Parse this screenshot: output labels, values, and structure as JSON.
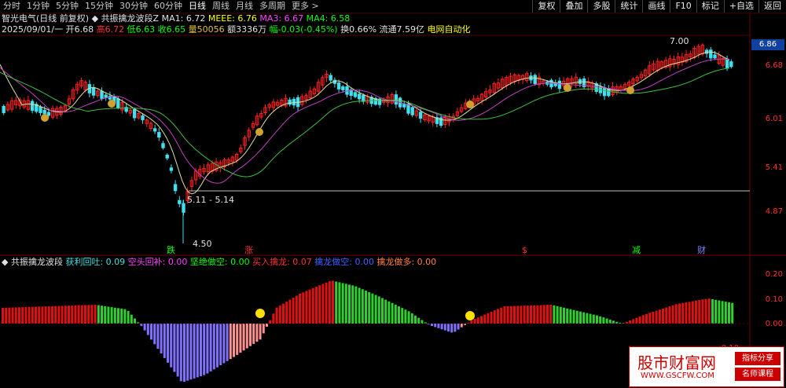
{
  "toolbar": {
    "periods": [
      "分时",
      "1分钟",
      "5分钟",
      "15分钟",
      "30分钟",
      "60分钟",
      "日线",
      "周线",
      "月线",
      "多周期",
      "更多 >"
    ],
    "buttons": [
      "复权",
      "叠加",
      "多股",
      "统计",
      "画线",
      "F10",
      "标记",
      "+自选",
      "返回"
    ]
  },
  "header": {
    "stock": "智光电气(日线 前复权)",
    "indicator": "共振擒龙波段Z",
    "ma1": "MA1: 6.72",
    "meee": "MEEE: 6.76",
    "ma3": "MA3: 6.67",
    "ma4": "MA4: 6.58"
  },
  "quote": {
    "date": "2025/09/01/一",
    "open": "开6.68",
    "high": "高6.72",
    "low": "低6.63",
    "close": "收6.65",
    "volume": "量50056",
    "amount": "额3336万",
    "change": "幅-0.03(-0.45%)",
    "turnover": "换0.66%",
    "float": "流通7.59亿",
    "sector": "电网自动化"
  },
  "price_axis": [
    "6.68",
    "6.01",
    "5.41",
    "4.87"
  ],
  "current_price": "6.86",
  "annotations": {
    "high_label": "7.00",
    "range_label": "5.11 - 5.14",
    "low_label": "4.50",
    "markers": [
      "跌",
      "涨",
      "$",
      "减",
      "财"
    ]
  },
  "sub_indicator": {
    "name": "共振擒龙波段",
    "items": [
      {
        "label": "获利回吐: 0.09",
        "color": "#40e0e0"
      },
      {
        "label": "空头回补: 0.00",
        "color": "#ff40ff"
      },
      {
        "label": "坚绝做空: 0.00",
        "color": "#00ff00"
      },
      {
        "label": "买入擒龙: 0.07",
        "color": "#ff3030"
      },
      {
        "label": "擒龙做空: 0.00",
        "color": "#4060ff"
      },
      {
        "label": "擒龙做多: 0.00",
        "color": "#ff8040"
      }
    ],
    "axis": [
      "0.20",
      "0.10",
      "0.00",
      "-0.10"
    ]
  },
  "watermark": {
    "main": "股市财富网",
    "url": "WWW.GSCFW.COM",
    "tag1": "指标分享",
    "tag2": "名师课程"
  },
  "colors": {
    "up": "#ff2020",
    "down": "#40e0f0",
    "ma1": "#e0e0a0",
    "ma2": "#c040c0",
    "ma3": "#40c040",
    "hist_red": "#e01010",
    "hist_purple": "#8070ff",
    "hist_pink": "#ff9090",
    "hist_green": "#30d030"
  }
}
